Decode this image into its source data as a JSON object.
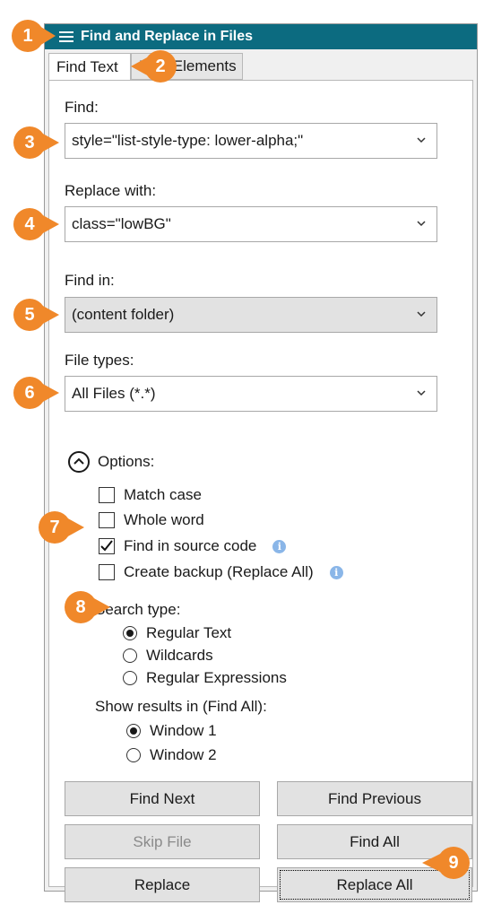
{
  "window": {
    "title": "Find and Replace in Files"
  },
  "tabs": [
    {
      "label": "Find Text",
      "active": true
    },
    {
      "label": "Find Elements",
      "active": false
    }
  ],
  "find": {
    "label": "Find:",
    "value": "style=\"list-style-type: lower-alpha;\""
  },
  "replace": {
    "label": "Replace with:",
    "value": "class=\"lowBG\""
  },
  "find_in": {
    "label": "Find in:",
    "value": "(content folder)"
  },
  "file_types": {
    "label": "File types:",
    "value": "All Files (*.*)"
  },
  "options": {
    "label": "Options:",
    "expanded": true,
    "checkboxes": [
      {
        "label": "Match case",
        "checked": false
      },
      {
        "label": "Whole word",
        "checked": false
      },
      {
        "label": "Find in source code",
        "checked": true,
        "info": true
      },
      {
        "label": "Create backup (Replace All)",
        "checked": false,
        "info": true
      }
    ]
  },
  "search_type": {
    "label": "Search type:",
    "options": [
      {
        "label": "Regular Text",
        "selected": true
      },
      {
        "label": "Wildcards",
        "selected": false
      },
      {
        "label": "Regular Expressions",
        "selected": false
      }
    ]
  },
  "show_results": {
    "label": "Show results in (Find All):",
    "options": [
      {
        "label": "Window 1",
        "selected": true
      },
      {
        "label": "Window 2",
        "selected": false
      }
    ]
  },
  "buttons": {
    "find_next": "Find Next",
    "find_previous": "Find Previous",
    "skip_file": "Skip File",
    "find_all": "Find All",
    "replace": "Replace",
    "replace_all": "Replace All"
  },
  "callouts": [
    "1",
    "2",
    "3",
    "4",
    "5",
    "6",
    "7",
    "8",
    "9"
  ],
  "colors": {
    "titlebar": "#0c6b80",
    "callout": "#f0882a",
    "info_icon": "#8ab6e8"
  },
  "icons": {
    "menu": "hamburger-menu-icon",
    "dropdown": "chevron-down-icon",
    "options": "chevron-up-circle-icon",
    "info": "info-icon"
  }
}
